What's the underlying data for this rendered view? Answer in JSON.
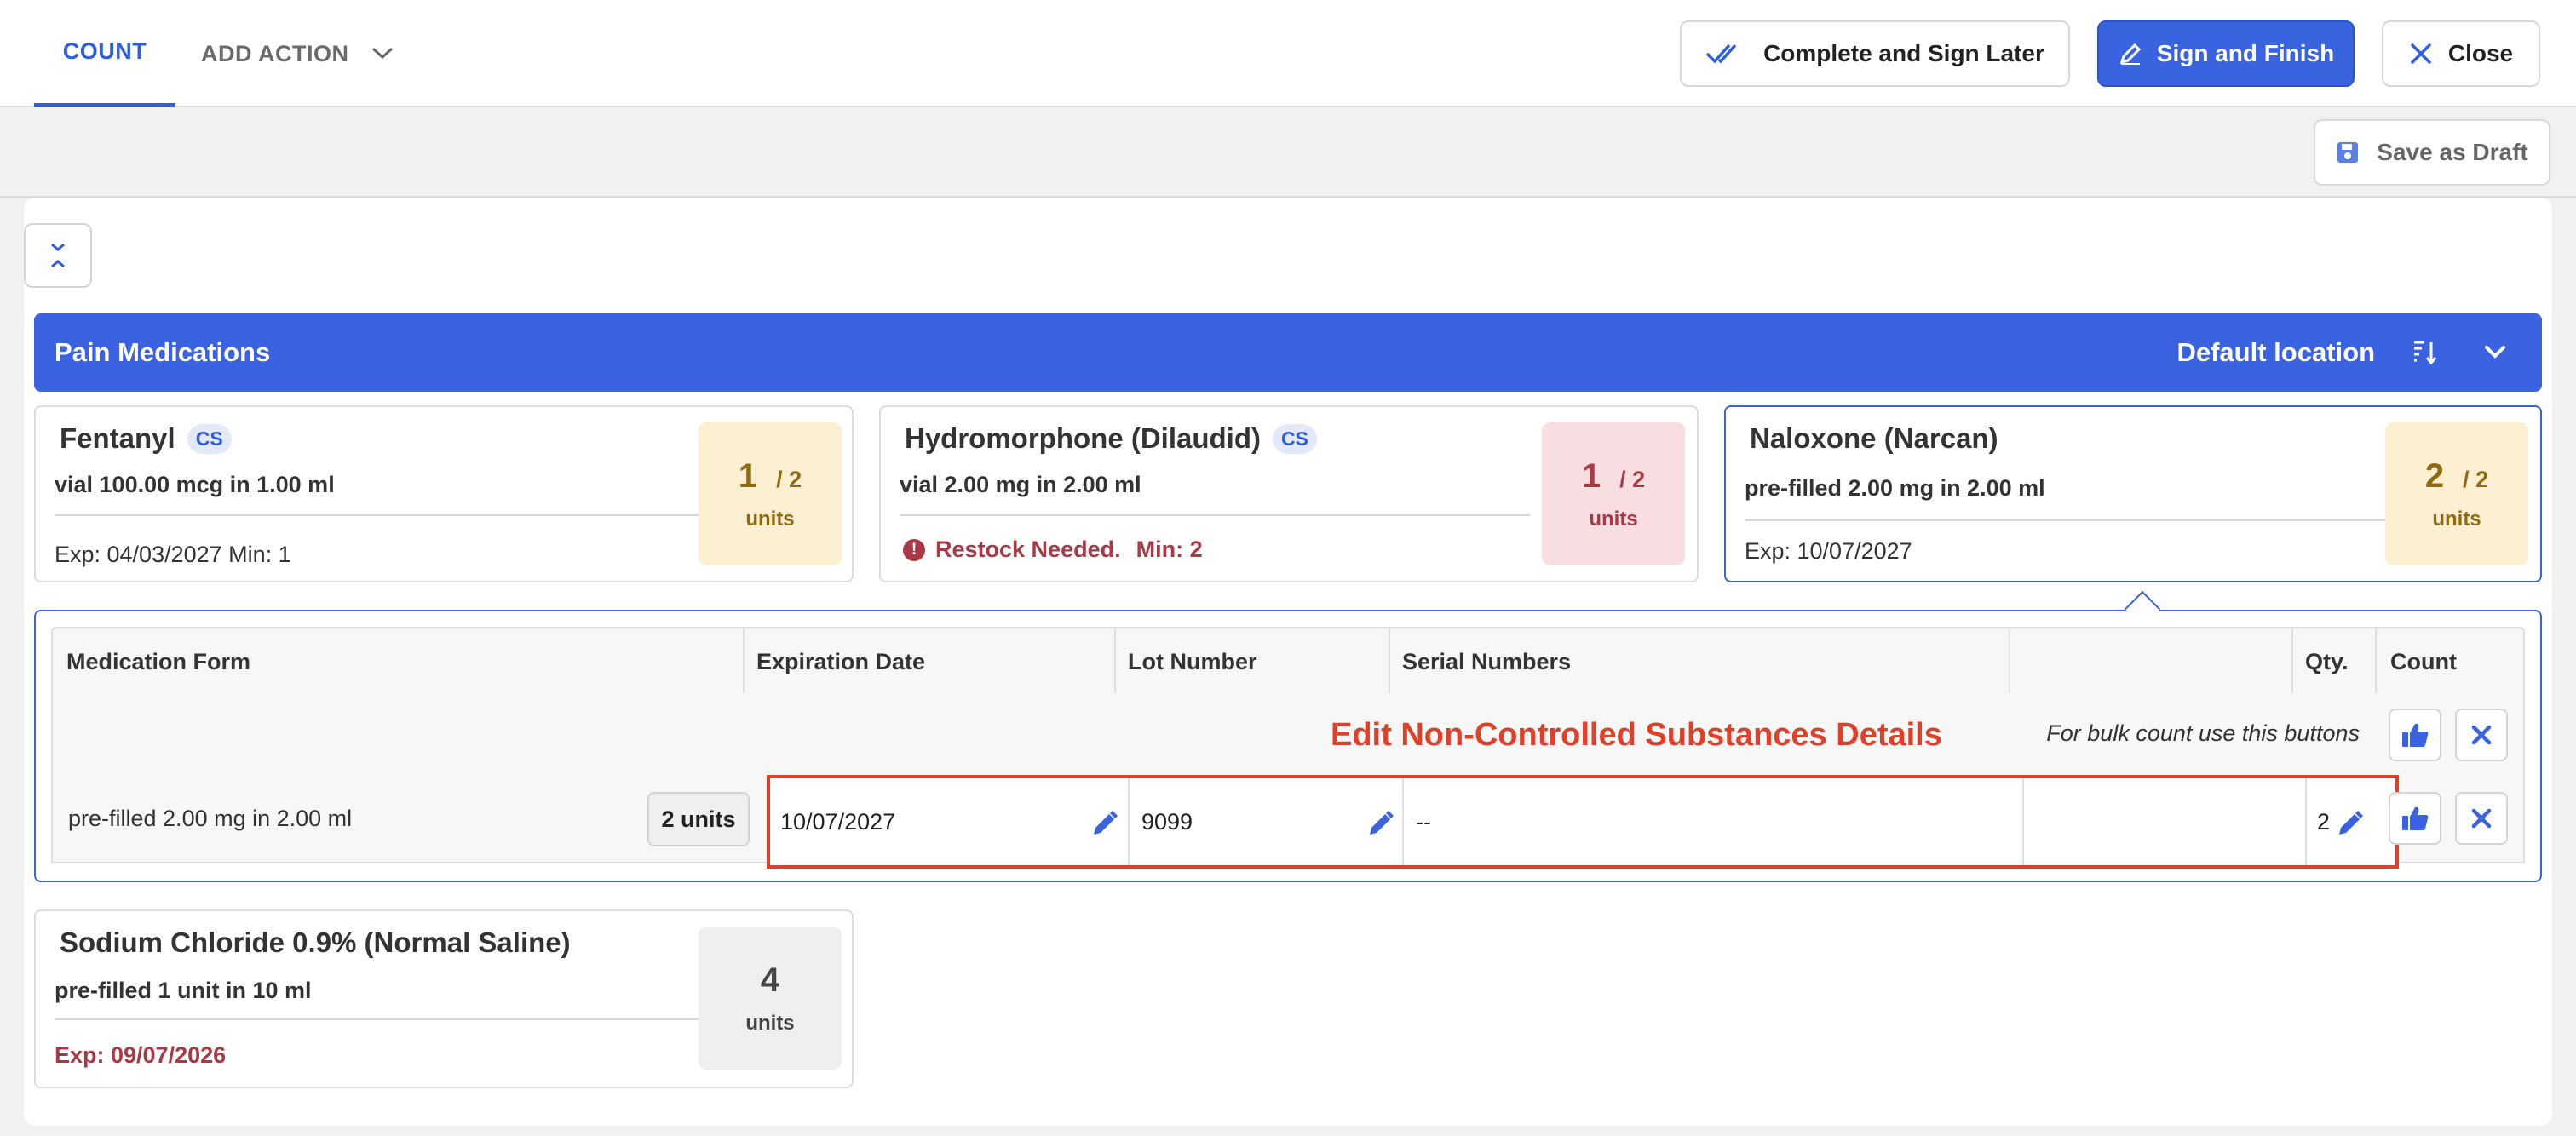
{
  "tabs": {
    "count": "COUNT",
    "add_action": "ADD ACTION"
  },
  "toolbar": {
    "complete_later": "Complete and Sign Later",
    "sign_finish": "Sign and Finish",
    "close": "Close",
    "save_draft": "Save as Draft"
  },
  "section": {
    "title": "Pain Medications",
    "location": "Default location"
  },
  "cards": [
    {
      "name": "Fentanyl",
      "badge": "CS",
      "desc": "vial 100.00 mcg in 1.00 ml",
      "exp": "Exp: 04/03/2027 Min: 1",
      "qty": "1",
      "qty_of": "/ 2",
      "units": "units"
    },
    {
      "name": "Hydromorphone (Dilaudid)",
      "badge": "CS",
      "desc": "vial 2.00 mg in 2.00 ml",
      "warning": "Restock Needed.",
      "warning_min": "Min: 2",
      "qty": "1",
      "qty_of": "/ 2",
      "units": "units"
    },
    {
      "name": "Naloxone (Narcan)",
      "desc": "pre-filled 2.00 mg in 2.00 ml",
      "exp": "Exp: 10/07/2027",
      "qty": "2",
      "qty_of": "/ 2",
      "units": "units"
    },
    {
      "name": "Sodium Chloride 0.9% (Normal Saline)",
      "desc": "pre-filled 1 unit in 10 ml",
      "exp": "Exp: 09/07/2026",
      "qty": "4",
      "units": "units"
    }
  ],
  "details": {
    "columns": [
      "Medication Form",
      "Expiration Date",
      "Lot Number",
      "Serial Numbers",
      "",
      "Qty.",
      "Count"
    ],
    "caption": "Edit Non-Controlled Substances Details",
    "bulk_hint": "For bulk count use this buttons",
    "row": {
      "form": "pre-filled 2.00 mg in 2.00 ml",
      "units_pill": "2 units",
      "expiration": "10/07/2027",
      "lot": "9099",
      "serial": "--",
      "qty": "2"
    }
  },
  "colors": {
    "accent": "#3b63e1",
    "danger": "#a83a48",
    "annotation": "#e0402a"
  }
}
